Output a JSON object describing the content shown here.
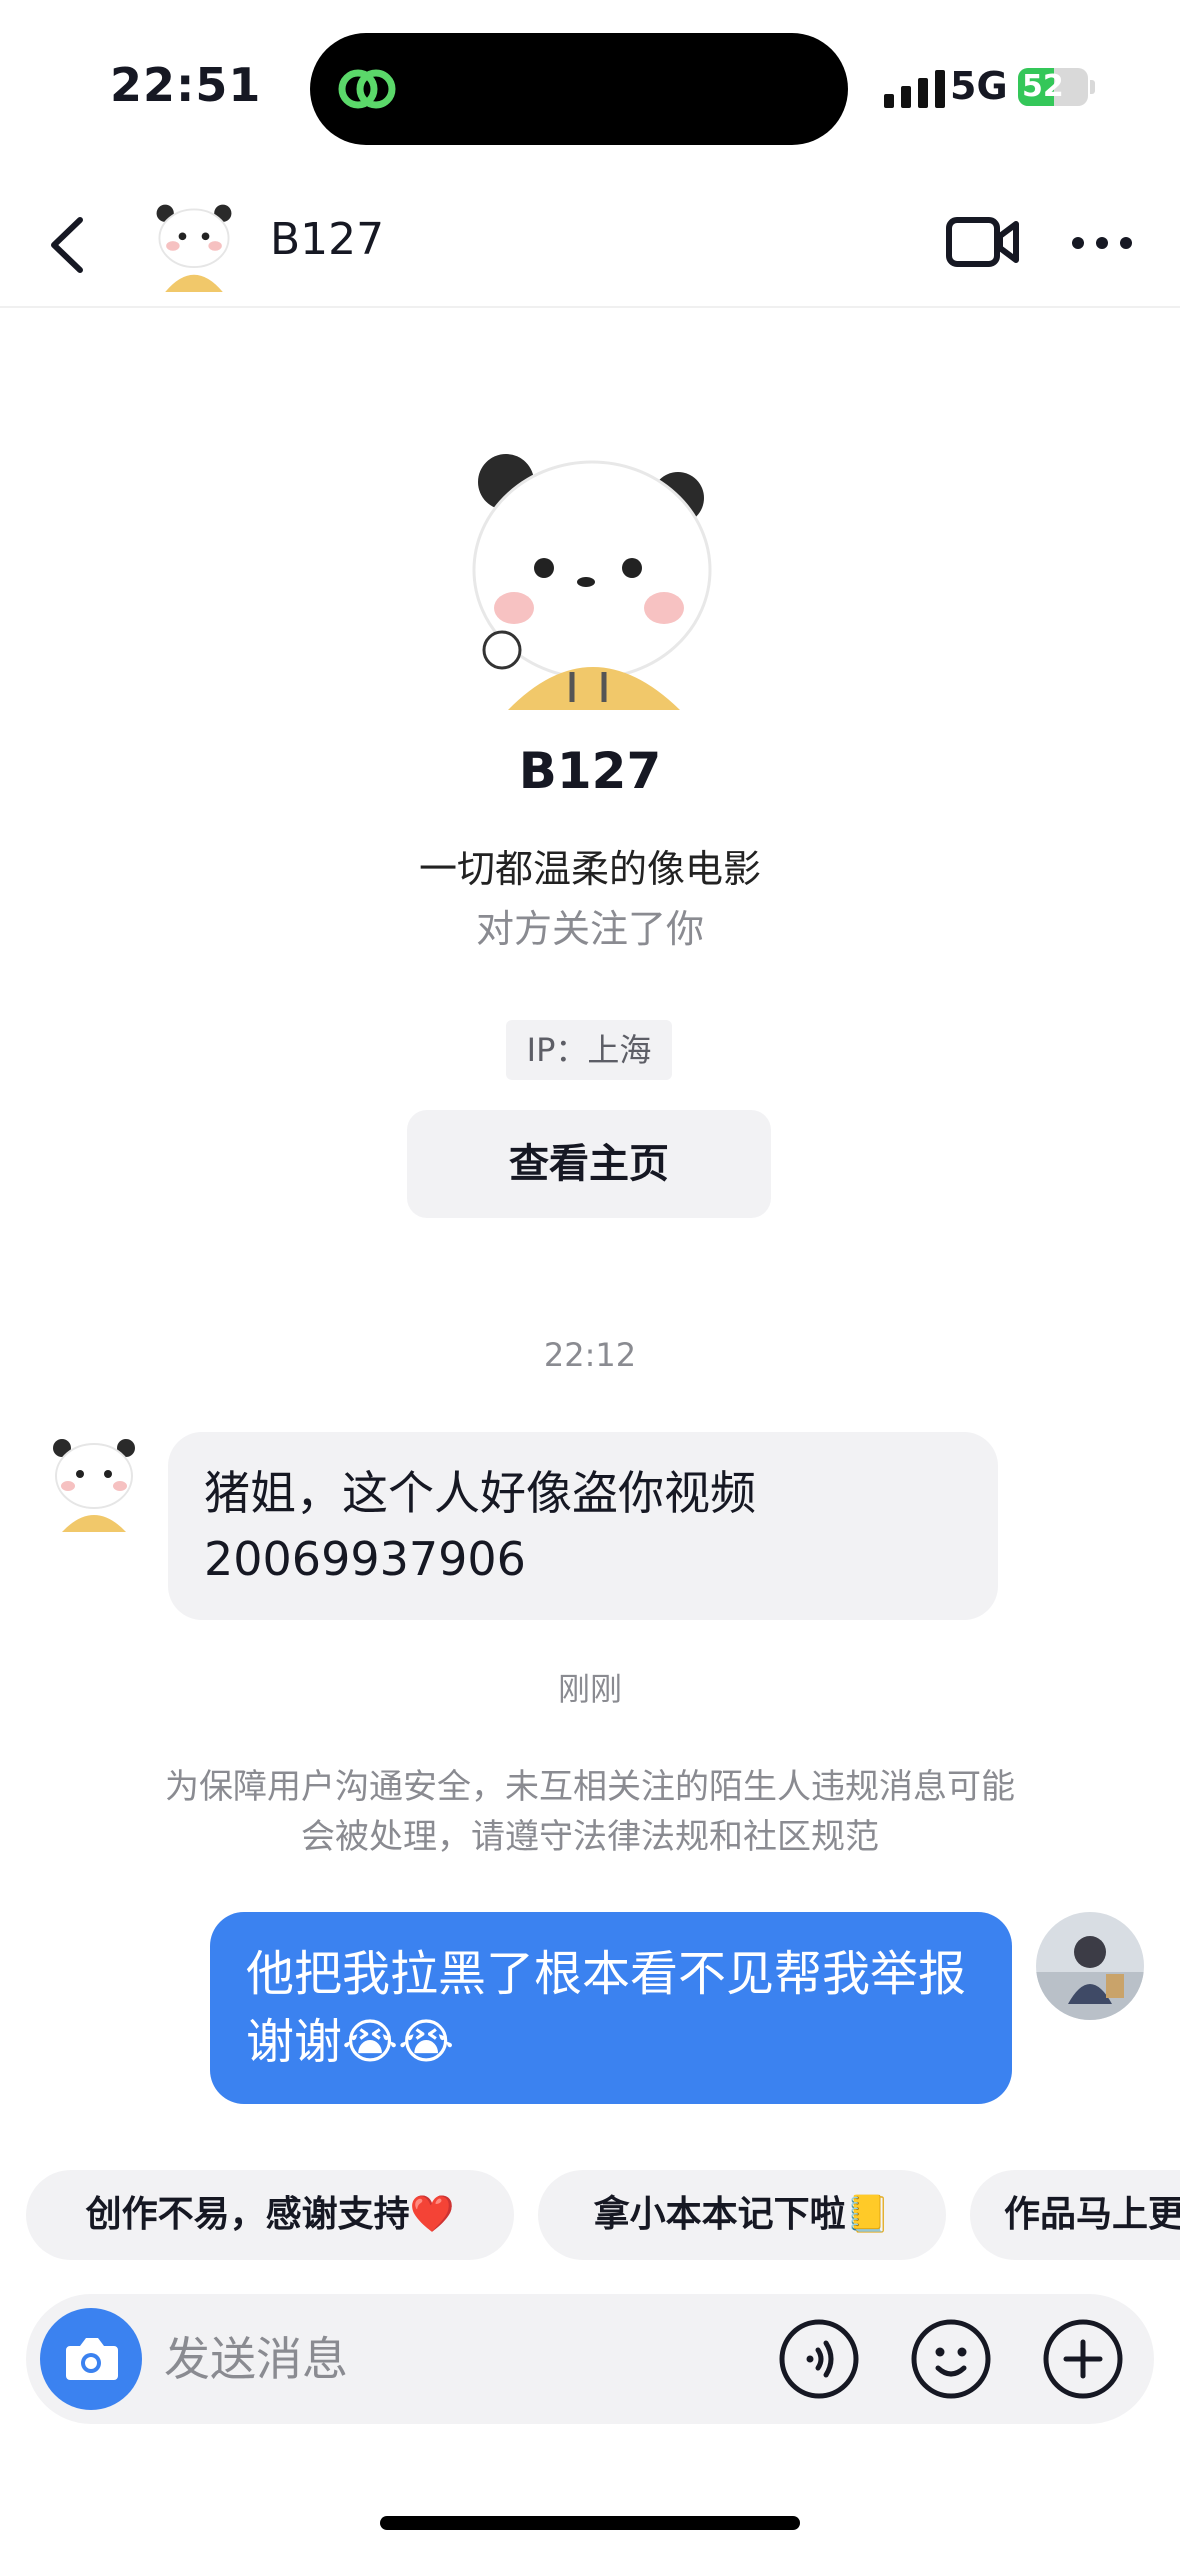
{
  "status_bar": {
    "time": "22:51",
    "network": "5G",
    "battery": "52",
    "battery_level": 0.52
  },
  "header": {
    "contact_name": "B127"
  },
  "profile": {
    "name": "B127",
    "bio": "一切都温柔的像电影",
    "follow_status": "对方关注了你",
    "ip_location": "IP：上海",
    "view_profile_label": "查看主页"
  },
  "chat": {
    "timestamp_1": "22:12",
    "incoming_message": "猪姐，这个人好像盗你视频 20069937906",
    "timestamp_2": "刚刚",
    "safety_notice": "为保障用户沟通安全，未互相关注的陌生人违规消息可能会被处理，请遵守法律法规和社区规范",
    "outgoing_message": "他把我拉黑了根本看不见帮我举报谢谢😭😭"
  },
  "quick_replies": [
    "创作不易，感谢支持❤️",
    "拿小本本记下啦📒",
    "作品马上更"
  ],
  "input": {
    "placeholder": "发送消息"
  },
  "colors": {
    "accent_blue": "#3b82f0",
    "bubble_gray": "#f2f2f4",
    "muted_text": "#8a8b91",
    "battery_green": "#34c759"
  },
  "icons": [
    "back-icon",
    "video-call-icon",
    "more-icon",
    "camera-icon",
    "voice-icon",
    "emoji-icon",
    "plus-icon"
  ]
}
